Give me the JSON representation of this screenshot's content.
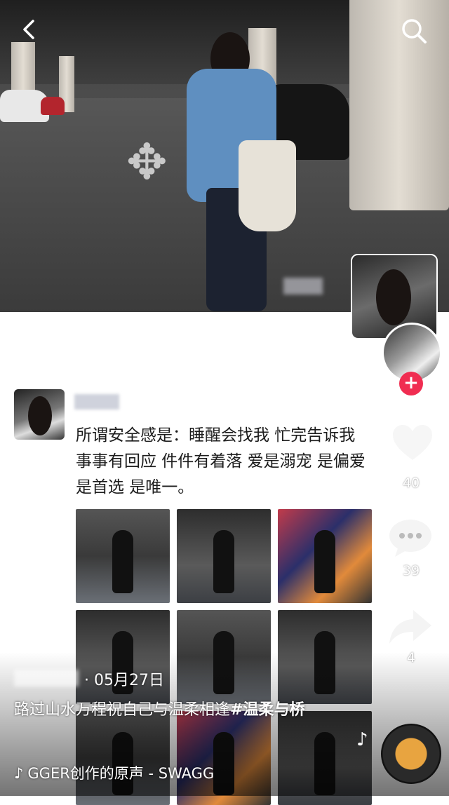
{
  "header": {
    "back_icon": "chevron-left-icon",
    "search_icon": "search-icon"
  },
  "post": {
    "text": "所谓安全感是：睡醒会找我 忙完告诉我 事事有回应 件件有着落 爱是溺宠 是偏爱 是首选 是唯一。",
    "image_count": 9
  },
  "actions": {
    "like_count": "40",
    "comment_count": "39",
    "share_count": "4",
    "follow_label": "+"
  },
  "video_info": {
    "date": "· 05月27日",
    "caption": "路过山水万程祝自己与温柔相逢",
    "hashtag": "#温柔与桥",
    "music": "GGER创作的原声 - SWAGG",
    "tiktok_icon": "tiktok-note-icon"
  },
  "colors": {
    "follow_red": "#f02d51",
    "shirt_blue": "#5f8fc0"
  }
}
